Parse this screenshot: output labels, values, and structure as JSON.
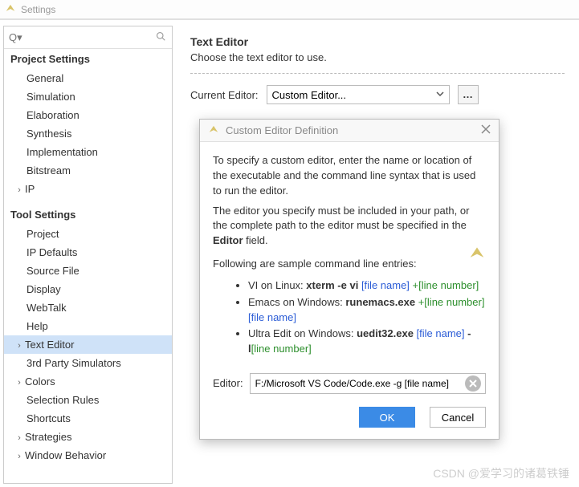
{
  "window": {
    "title": "Settings"
  },
  "search": {
    "placeholder": "Q▾"
  },
  "tree": {
    "group1": {
      "label": "Project Settings",
      "items": [
        "General",
        "Simulation",
        "Elaboration",
        "Synthesis",
        "Implementation",
        "Bitstream"
      ],
      "expandable": "IP"
    },
    "group2": {
      "label": "Tool Settings",
      "items": [
        "Project",
        "IP Defaults",
        "Source File",
        "Display",
        "WebTalk",
        "Help",
        "Text Editor",
        "3rd Party Simulators"
      ],
      "exp": [
        "Colors",
        "Selection Rules",
        "Shortcuts",
        "Strategies",
        "Window Behavior"
      ]
    }
  },
  "panel": {
    "heading": "Text Editor",
    "sub": "Choose the text editor to use.",
    "cur_label": "Current Editor:",
    "cur_value": "Custom Editor...",
    "dots": "…"
  },
  "dialog": {
    "title": "Custom Editor Definition",
    "p1": "To specify a custom editor, enter the name or location of the executable and the command line syntax that is used to run the editor.",
    "p2a": "The editor you specify must be included in your path, or the complete path to the editor must be specified in the ",
    "p2b": "Editor",
    "p2c": " field.",
    "p3": "Following are sample command line entries:",
    "s1a": "VI on Linux: ",
    "s1b": "xterm -e vi ",
    "s1c": "[file name] ",
    "s1d": "+[line number]",
    "s2a": "Emacs on Windows: ",
    "s2b": "runemacs.exe ",
    "s2c": "+[line number] ",
    "s2d": "[file name]",
    "s3a": "Ultra Edit on Windows: ",
    "s3b": "uedit32.exe ",
    "s3c": "[file name] ",
    "s3d": "-l",
    "s3e": "[line number]",
    "ed_label": "Editor:",
    "ed_value": "F:/Microsoft VS Code/Code.exe -g [file name]",
    "ok": "OK",
    "cancel": "Cancel"
  },
  "watermark": "CSDN @爱学习的诸葛铁锤"
}
